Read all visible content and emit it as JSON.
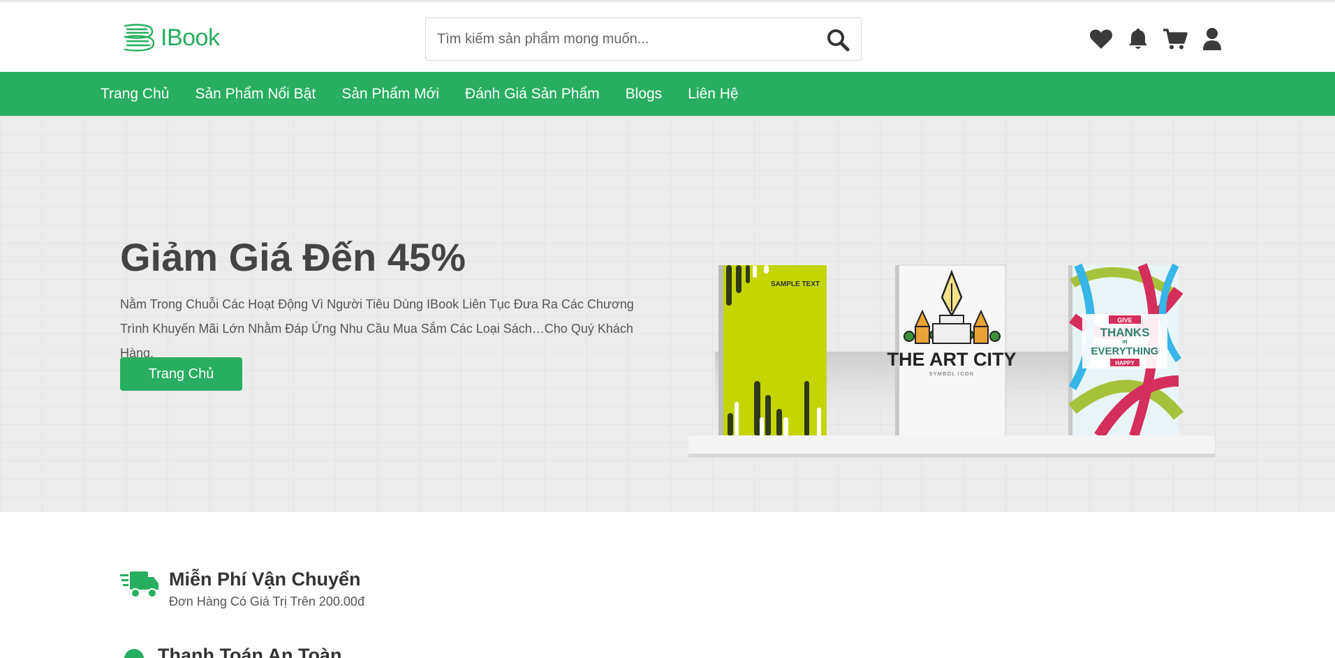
{
  "brand": {
    "name": "IBook",
    "color": "#27ae60"
  },
  "search": {
    "placeholder": "Tìm kiếm sản phẩm mong muốn..."
  },
  "header_icons": [
    "heart-icon",
    "bell-icon",
    "cart-icon",
    "user-icon"
  ],
  "nav": {
    "items": [
      {
        "label": "Trang Chủ"
      },
      {
        "label": "Sản Phẩm Nổi Bật"
      },
      {
        "label": "Sản Phẩm Mới"
      },
      {
        "label": "Đánh Giá Sản Phẩm"
      },
      {
        "label": "Blogs"
      },
      {
        "label": "Liên Hệ"
      }
    ]
  },
  "hero": {
    "title": "Giảm Giá Đến 45%",
    "description": "Nằm Trong Chuỗi Các Hoạt Động Vì Người Tiêu Dùng IBook Liên Tục Đưa Ra Các Chương Trình Khuyến Mãi Lớn Nhằm Đáp Ứng Nhu Cầu Mua Sắm Các Loại Sách…Cho Quý Khách Hàng.",
    "button": "Trang Chủ",
    "books": [
      {
        "text": "SAMPLE TEXT"
      },
      {
        "title": "THE ART CITY",
        "subtitle": "SYMBOL ICON"
      },
      {
        "line1": "GIVE",
        "line2": "THANKS",
        "line3": "IN",
        "line4": "EVERYTHING",
        "line5": "HAPPY"
      }
    ]
  },
  "features": [
    {
      "title": "Miễn Phí Vận Chuyển",
      "subtitle": "Đơn Hàng Có Giá Trị Trên 200.00đ",
      "icon": "truck-icon"
    },
    {
      "title": "Thanh Toán An Toàn",
      "icon": "shield-icon"
    }
  ]
}
